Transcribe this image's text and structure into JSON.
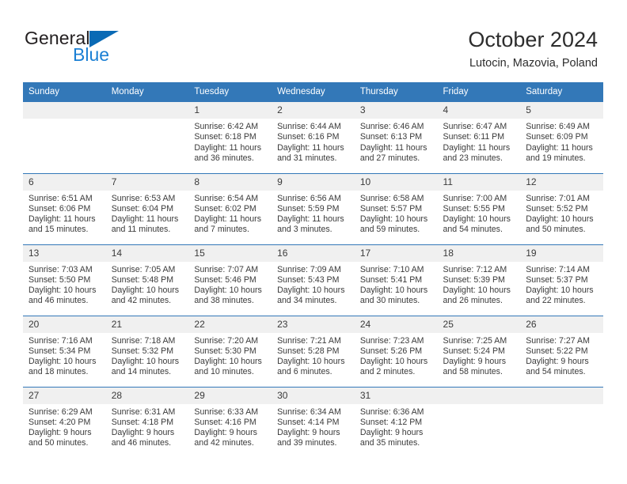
{
  "brand": {
    "name_part1": "General",
    "name_part2": "Blue",
    "triangle_color": "#0a6ab5",
    "blue_text_color": "#1a7fd4"
  },
  "header": {
    "title": "October 2024",
    "subtitle": "Lutocin, Mazovia, Poland"
  },
  "theme": {
    "header_row_bg": "#3378b8",
    "header_row_text": "#ffffff",
    "daynum_bg": "#f0f0f0",
    "cell_bg": "#ffffff",
    "grid_line": "#3378b8",
    "body_text": "#3a3a3a"
  },
  "labels": {
    "sunrise_prefix": "Sunrise:",
    "sunset_prefix": "Sunset:",
    "daylight_prefix": "Daylight:"
  },
  "weekday_headers": [
    "Sunday",
    "Monday",
    "Tuesday",
    "Wednesday",
    "Thursday",
    "Friday",
    "Saturday"
  ],
  "weeks": [
    [
      {
        "day": "",
        "empty": true
      },
      {
        "day": "",
        "empty": true
      },
      {
        "day": "1",
        "sunrise": "Sunrise: 6:42 AM",
        "sunset": "Sunset: 6:18 PM",
        "daylight_l1": "Daylight: 11 hours",
        "daylight_l2": "and 36 minutes."
      },
      {
        "day": "2",
        "sunrise": "Sunrise: 6:44 AM",
        "sunset": "Sunset: 6:16 PM",
        "daylight_l1": "Daylight: 11 hours",
        "daylight_l2": "and 31 minutes."
      },
      {
        "day": "3",
        "sunrise": "Sunrise: 6:46 AM",
        "sunset": "Sunset: 6:13 PM",
        "daylight_l1": "Daylight: 11 hours",
        "daylight_l2": "and 27 minutes."
      },
      {
        "day": "4",
        "sunrise": "Sunrise: 6:47 AM",
        "sunset": "Sunset: 6:11 PM",
        "daylight_l1": "Daylight: 11 hours",
        "daylight_l2": "and 23 minutes."
      },
      {
        "day": "5",
        "sunrise": "Sunrise: 6:49 AM",
        "sunset": "Sunset: 6:09 PM",
        "daylight_l1": "Daylight: 11 hours",
        "daylight_l2": "and 19 minutes."
      }
    ],
    [
      {
        "day": "6",
        "sunrise": "Sunrise: 6:51 AM",
        "sunset": "Sunset: 6:06 PM",
        "daylight_l1": "Daylight: 11 hours",
        "daylight_l2": "and 15 minutes."
      },
      {
        "day": "7",
        "sunrise": "Sunrise: 6:53 AM",
        "sunset": "Sunset: 6:04 PM",
        "daylight_l1": "Daylight: 11 hours",
        "daylight_l2": "and 11 minutes."
      },
      {
        "day": "8",
        "sunrise": "Sunrise: 6:54 AM",
        "sunset": "Sunset: 6:02 PM",
        "daylight_l1": "Daylight: 11 hours",
        "daylight_l2": "and 7 minutes."
      },
      {
        "day": "9",
        "sunrise": "Sunrise: 6:56 AM",
        "sunset": "Sunset: 5:59 PM",
        "daylight_l1": "Daylight: 11 hours",
        "daylight_l2": "and 3 minutes."
      },
      {
        "day": "10",
        "sunrise": "Sunrise: 6:58 AM",
        "sunset": "Sunset: 5:57 PM",
        "daylight_l1": "Daylight: 10 hours",
        "daylight_l2": "and 59 minutes."
      },
      {
        "day": "11",
        "sunrise": "Sunrise: 7:00 AM",
        "sunset": "Sunset: 5:55 PM",
        "daylight_l1": "Daylight: 10 hours",
        "daylight_l2": "and 54 minutes."
      },
      {
        "day": "12",
        "sunrise": "Sunrise: 7:01 AM",
        "sunset": "Sunset: 5:52 PM",
        "daylight_l1": "Daylight: 10 hours",
        "daylight_l2": "and 50 minutes."
      }
    ],
    [
      {
        "day": "13",
        "sunrise": "Sunrise: 7:03 AM",
        "sunset": "Sunset: 5:50 PM",
        "daylight_l1": "Daylight: 10 hours",
        "daylight_l2": "and 46 minutes."
      },
      {
        "day": "14",
        "sunrise": "Sunrise: 7:05 AM",
        "sunset": "Sunset: 5:48 PM",
        "daylight_l1": "Daylight: 10 hours",
        "daylight_l2": "and 42 minutes."
      },
      {
        "day": "15",
        "sunrise": "Sunrise: 7:07 AM",
        "sunset": "Sunset: 5:46 PM",
        "daylight_l1": "Daylight: 10 hours",
        "daylight_l2": "and 38 minutes."
      },
      {
        "day": "16",
        "sunrise": "Sunrise: 7:09 AM",
        "sunset": "Sunset: 5:43 PM",
        "daylight_l1": "Daylight: 10 hours",
        "daylight_l2": "and 34 minutes."
      },
      {
        "day": "17",
        "sunrise": "Sunrise: 7:10 AM",
        "sunset": "Sunset: 5:41 PM",
        "daylight_l1": "Daylight: 10 hours",
        "daylight_l2": "and 30 minutes."
      },
      {
        "day": "18",
        "sunrise": "Sunrise: 7:12 AM",
        "sunset": "Sunset: 5:39 PM",
        "daylight_l1": "Daylight: 10 hours",
        "daylight_l2": "and 26 minutes."
      },
      {
        "day": "19",
        "sunrise": "Sunrise: 7:14 AM",
        "sunset": "Sunset: 5:37 PM",
        "daylight_l1": "Daylight: 10 hours",
        "daylight_l2": "and 22 minutes."
      }
    ],
    [
      {
        "day": "20",
        "sunrise": "Sunrise: 7:16 AM",
        "sunset": "Sunset: 5:34 PM",
        "daylight_l1": "Daylight: 10 hours",
        "daylight_l2": "and 18 minutes."
      },
      {
        "day": "21",
        "sunrise": "Sunrise: 7:18 AM",
        "sunset": "Sunset: 5:32 PM",
        "daylight_l1": "Daylight: 10 hours",
        "daylight_l2": "and 14 minutes."
      },
      {
        "day": "22",
        "sunrise": "Sunrise: 7:20 AM",
        "sunset": "Sunset: 5:30 PM",
        "daylight_l1": "Daylight: 10 hours",
        "daylight_l2": "and 10 minutes."
      },
      {
        "day": "23",
        "sunrise": "Sunrise: 7:21 AM",
        "sunset": "Sunset: 5:28 PM",
        "daylight_l1": "Daylight: 10 hours",
        "daylight_l2": "and 6 minutes."
      },
      {
        "day": "24",
        "sunrise": "Sunrise: 7:23 AM",
        "sunset": "Sunset: 5:26 PM",
        "daylight_l1": "Daylight: 10 hours",
        "daylight_l2": "and 2 minutes."
      },
      {
        "day": "25",
        "sunrise": "Sunrise: 7:25 AM",
        "sunset": "Sunset: 5:24 PM",
        "daylight_l1": "Daylight: 9 hours",
        "daylight_l2": "and 58 minutes."
      },
      {
        "day": "26",
        "sunrise": "Sunrise: 7:27 AM",
        "sunset": "Sunset: 5:22 PM",
        "daylight_l1": "Daylight: 9 hours",
        "daylight_l2": "and 54 minutes."
      }
    ],
    [
      {
        "day": "27",
        "sunrise": "Sunrise: 6:29 AM",
        "sunset": "Sunset: 4:20 PM",
        "daylight_l1": "Daylight: 9 hours",
        "daylight_l2": "and 50 minutes."
      },
      {
        "day": "28",
        "sunrise": "Sunrise: 6:31 AM",
        "sunset": "Sunset: 4:18 PM",
        "daylight_l1": "Daylight: 9 hours",
        "daylight_l2": "and 46 minutes."
      },
      {
        "day": "29",
        "sunrise": "Sunrise: 6:33 AM",
        "sunset": "Sunset: 4:16 PM",
        "daylight_l1": "Daylight: 9 hours",
        "daylight_l2": "and 42 minutes."
      },
      {
        "day": "30",
        "sunrise": "Sunrise: 6:34 AM",
        "sunset": "Sunset: 4:14 PM",
        "daylight_l1": "Daylight: 9 hours",
        "daylight_l2": "and 39 minutes."
      },
      {
        "day": "31",
        "sunrise": "Sunrise: 6:36 AM",
        "sunset": "Sunset: 4:12 PM",
        "daylight_l1": "Daylight: 9 hours",
        "daylight_l2": "and 35 minutes."
      },
      {
        "day": "",
        "empty": true
      },
      {
        "day": "",
        "empty": true
      }
    ]
  ]
}
